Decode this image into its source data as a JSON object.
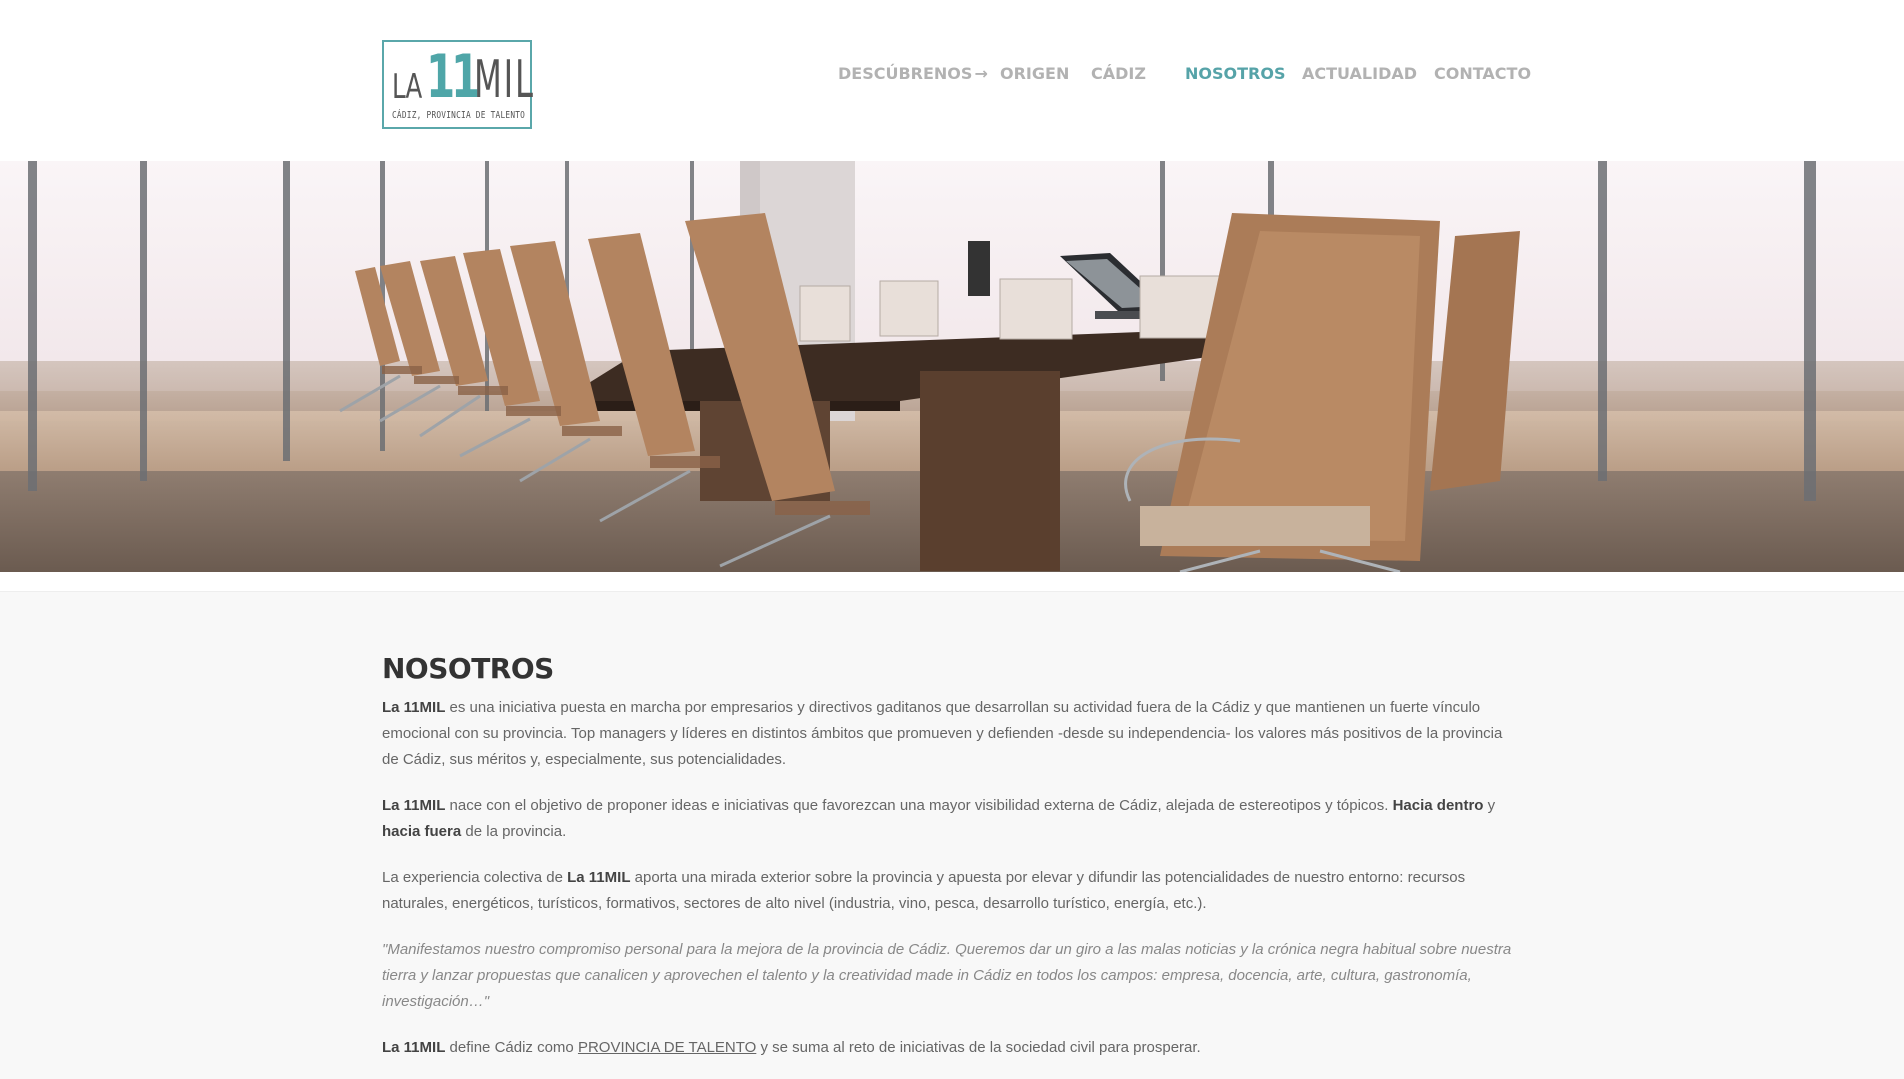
{
  "logo": {
    "la": "LA",
    "eleven": "11",
    "mil": "MIL",
    "tagline": "CÁDIZ, PROVINCIA DE TALENTO"
  },
  "nav": {
    "items": [
      {
        "label": "DESCÚBRENOS",
        "has_arrow": true
      },
      {
        "label": "ORIGEN"
      },
      {
        "label": "CÁDIZ"
      },
      {
        "label": "NOSOTROS",
        "active": true
      },
      {
        "label": "ACTUALIDAD"
      },
      {
        "label": "CONTACTO"
      }
    ],
    "arrow": "→"
  },
  "colors": {
    "accent": "#56a3a8",
    "nav_inactive": "#b2b2b2",
    "content_bg": "#f8f8f8"
  },
  "content": {
    "title": "NOSOTROS",
    "p1": {
      "bold": "La 11MIL",
      "text": " es una iniciativa puesta en marcha por empresarios y directivos gaditanos que desarrollan su actividad fuera de la Cádiz y que mantienen un fuerte vínculo emocional con su provincia. Top managers y líderes en distintos ámbitos que promueven y defienden -desde su independencia- los valores más positivos de la provincia de Cádiz, sus méritos y, especialmente, sus potencialidades."
    },
    "p2": {
      "bold1": "La 11MIL",
      "text1": " nace con el objetivo de proponer ideas e iniciativas que favorezcan una mayor visibilidad externa de Cádiz, alejada de estereotipos y tópicos. ",
      "bold2": "Hacia dentro",
      "text2": " y ",
      "bold3": "hacia fuera",
      "text3": " de la provincia."
    },
    "p3": {
      "text1": "La experiencia colectiva de ",
      "bold": "La 11MIL",
      "text2": " aporta una mirada exterior sobre la provincia y apuesta por elevar y difundir las potencialidades de nuestro entorno: recursos naturales, energéticos, turísticos, formativos, sectores de alto nivel (industria, vino, pesca, desarrollo turístico, energía, etc.)."
    },
    "quote": "\"Manifestamos nuestro compromiso personal para la mejora de la provincia de Cádiz. Queremos dar un giro a las malas noticias y la crónica negra habitual sobre nuestra tierra y lanzar propuestas que canalicen y aprovechen el talento y la creatividad made in Cádiz en todos los campos: empresa, docencia, arte, cultura, gastronomía, investigación…\"",
    "p5": {
      "bold": "La 11MIL",
      "text1": " define Cádiz como ",
      "link": "PROVINCIA DE TALENTO",
      "text2": " y se suma al reto de iniciativas de la sociedad civil para prosperar."
    }
  }
}
